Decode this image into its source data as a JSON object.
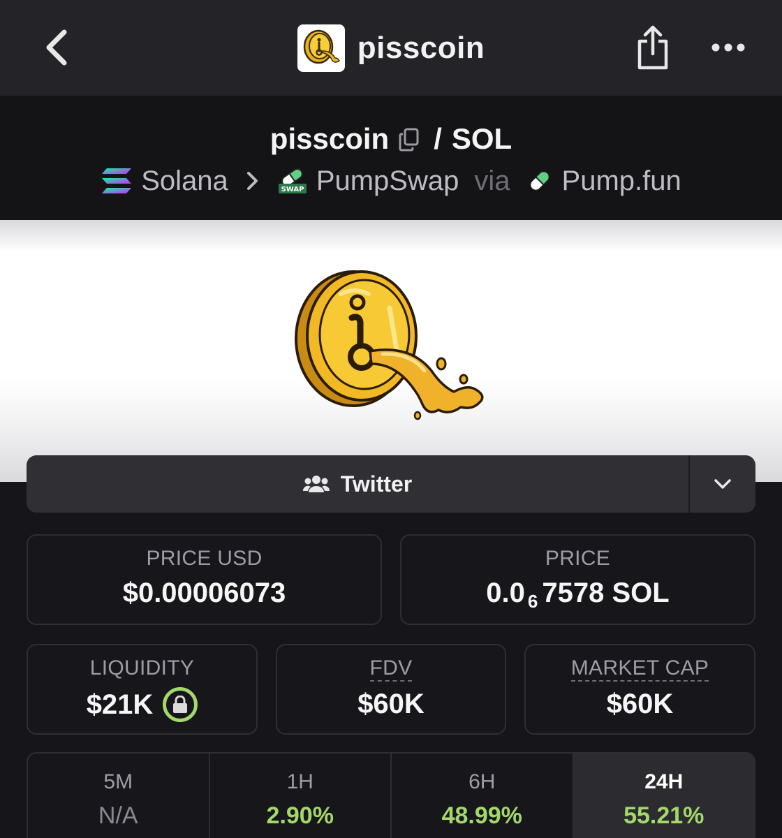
{
  "header": {
    "title": "pisscoin",
    "back_icon": "chevron-left-icon",
    "share_icon": "share-icon",
    "more_icon": "more-dots-icon"
  },
  "pair": {
    "base": "pisscoin",
    "separator": "/",
    "quote": "SOL",
    "chain": "Solana",
    "dex": "PumpSwap",
    "dex_badge": "SWAP",
    "via": "via",
    "launchpad": "Pump.fun"
  },
  "socials": {
    "label": "Twitter",
    "icon": "users-icon"
  },
  "stats": {
    "price_usd_label": "PRICE USD",
    "price_usd_value": "$0.00006073",
    "price_label": "PRICE",
    "price_prefix": "0.0",
    "price_zero_count": "6",
    "price_suffix": "7578 SOL",
    "liquidity_label": "LIQUIDITY",
    "liquidity_value": "$21K",
    "fdv_label": "FDV",
    "fdv_value": "$60K",
    "mcap_label": "MARKET CAP",
    "mcap_value": "$60K"
  },
  "timeframes": [
    {
      "label": "5M",
      "value": "N/A"
    },
    {
      "label": "1H",
      "value": "2.90%"
    },
    {
      "label": "6H",
      "value": "48.99%"
    },
    {
      "label": "24H",
      "value": "55.21%"
    }
  ],
  "colors": {
    "positive": "#a4d86a",
    "background": "#15151a",
    "topbar": "#242428"
  }
}
